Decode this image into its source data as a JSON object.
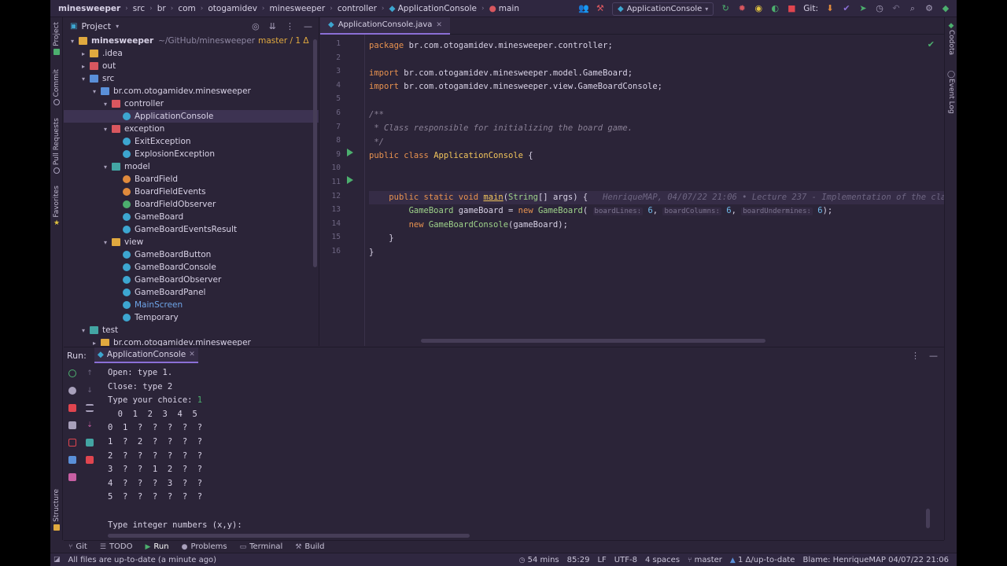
{
  "breadcrumbs": [
    "minesweeper",
    "src",
    "br",
    "com",
    "otogamidev",
    "minesweeper",
    "controller",
    "ApplicationConsole",
    "main"
  ],
  "toolbar": {
    "run_config": "ApplicationConsole",
    "git_label": "Git:"
  },
  "left_strip": [
    "Project",
    "Commit",
    "Pull Requests",
    "Favorites",
    "Structure"
  ],
  "right_strip": [
    "Codota",
    "Event Log"
  ],
  "project_panel": {
    "title": "Project",
    "root": {
      "name": "minesweeper",
      "path": "~/GitHub/minesweeper",
      "branch": "master / 1 Δ"
    },
    "items": [
      {
        "label": ".idea",
        "indent": 1,
        "arrow": "▸",
        "icon": "folder"
      },
      {
        "label": "out",
        "indent": 1,
        "arrow": "▸",
        "icon": "folder red"
      },
      {
        "label": "src",
        "indent": 1,
        "arrow": "▾",
        "icon": "folder blue"
      },
      {
        "label": "br.com.otogamidev.minesweeper",
        "indent": 2,
        "arrow": "▾",
        "icon": "folder blue"
      },
      {
        "label": "controller",
        "indent": 3,
        "arrow": "▾",
        "icon": "folder red"
      },
      {
        "label": "ApplicationConsole",
        "indent": 4,
        "arrow": "",
        "icon": "cls",
        "selected": true
      },
      {
        "label": "exception",
        "indent": 3,
        "arrow": "▾",
        "icon": "folder red"
      },
      {
        "label": "ExitException",
        "indent": 4,
        "arrow": "",
        "icon": "cls"
      },
      {
        "label": "ExplosionException",
        "indent": 4,
        "arrow": "",
        "icon": "cls"
      },
      {
        "label": "model",
        "indent": 3,
        "arrow": "▾",
        "icon": "folder teal"
      },
      {
        "label": "BoardField",
        "indent": 4,
        "arrow": "",
        "icon": "cls orange"
      },
      {
        "label": "BoardFieldEvents",
        "indent": 4,
        "arrow": "",
        "icon": "cls orange"
      },
      {
        "label": "BoardFieldObserver",
        "indent": 4,
        "arrow": "",
        "icon": "cls green"
      },
      {
        "label": "GameBoard",
        "indent": 4,
        "arrow": "",
        "icon": "cls"
      },
      {
        "label": "GameBoardEventsResult",
        "indent": 4,
        "arrow": "",
        "icon": "cls"
      },
      {
        "label": "view",
        "indent": 3,
        "arrow": "▾",
        "icon": "folder"
      },
      {
        "label": "GameBoardButton",
        "indent": 4,
        "arrow": "",
        "icon": "cls"
      },
      {
        "label": "GameBoardConsole",
        "indent": 4,
        "arrow": "",
        "icon": "cls"
      },
      {
        "label": "GameBoardObserver",
        "indent": 4,
        "arrow": "",
        "icon": "cls"
      },
      {
        "label": "GameBoardPanel",
        "indent": 4,
        "arrow": "",
        "icon": "cls"
      },
      {
        "label": "MainScreen",
        "indent": 4,
        "arrow": "",
        "icon": "cls",
        "link": true
      },
      {
        "label": "Temporary",
        "indent": 4,
        "arrow": "",
        "icon": "cls"
      },
      {
        "label": "test",
        "indent": 1,
        "arrow": "▾",
        "icon": "folder teal"
      },
      {
        "label": "br.com.otogamidev.minesweeper",
        "indent": 2,
        "arrow": "▸",
        "icon": "folder"
      }
    ]
  },
  "editor": {
    "tab": "ApplicationConsole.java",
    "line_numbers": [
      "1",
      "2",
      "3",
      "4",
      "5",
      "6",
      "7",
      "8",
      "9",
      "10",
      "11",
      "12",
      "13",
      "14",
      "15",
      "16"
    ],
    "blame": "HenriqueMAP, 04/07/22 21:06 • Lecture 237 - Implementation of the clas",
    "hints": [
      "boardLines:",
      "boardColumns:",
      "boardUndermines:"
    ]
  },
  "run_panel": {
    "label": "Run:",
    "tab": "ApplicationConsole",
    "output": [
      "Open: type 1.",
      "Close: type 2",
      "Type your choice: ",
      "  0  1  2  3  4  5",
      "0  1  ?  ?  ?  ?  ?",
      "1  ?  2  ?  ?  ?  ?",
      "2  ?  ?  ?  ?  ?  ?",
      "3  ?  ?  1  2  ?  ?",
      "4  ?  ?  ?  3  ?  ?",
      "5  ?  ?  ?  ?  ?  ?",
      "",
      "Type integer numbers (x,y):"
    ],
    "choice_input": "1"
  },
  "tool_tabs": [
    "Git",
    "TODO",
    "Run",
    "Problems",
    "Terminal",
    "Build"
  ],
  "status": {
    "message": "All files are up-to-date (a minute ago)",
    "time": "54 mins",
    "position": "85:29",
    "line_sep": "LF",
    "encoding": "UTF-8",
    "indent": "4 spaces",
    "branch": "master",
    "vcs": "1 Δ/up-to-date",
    "blame": "Blame: HenriqueMAP 04/07/22 21:06"
  },
  "colors": {
    "background": "#2b2438",
    "accent": "#8b6fd6",
    "run_green": "#4caf6e",
    "keyword": "#e8924f"
  }
}
